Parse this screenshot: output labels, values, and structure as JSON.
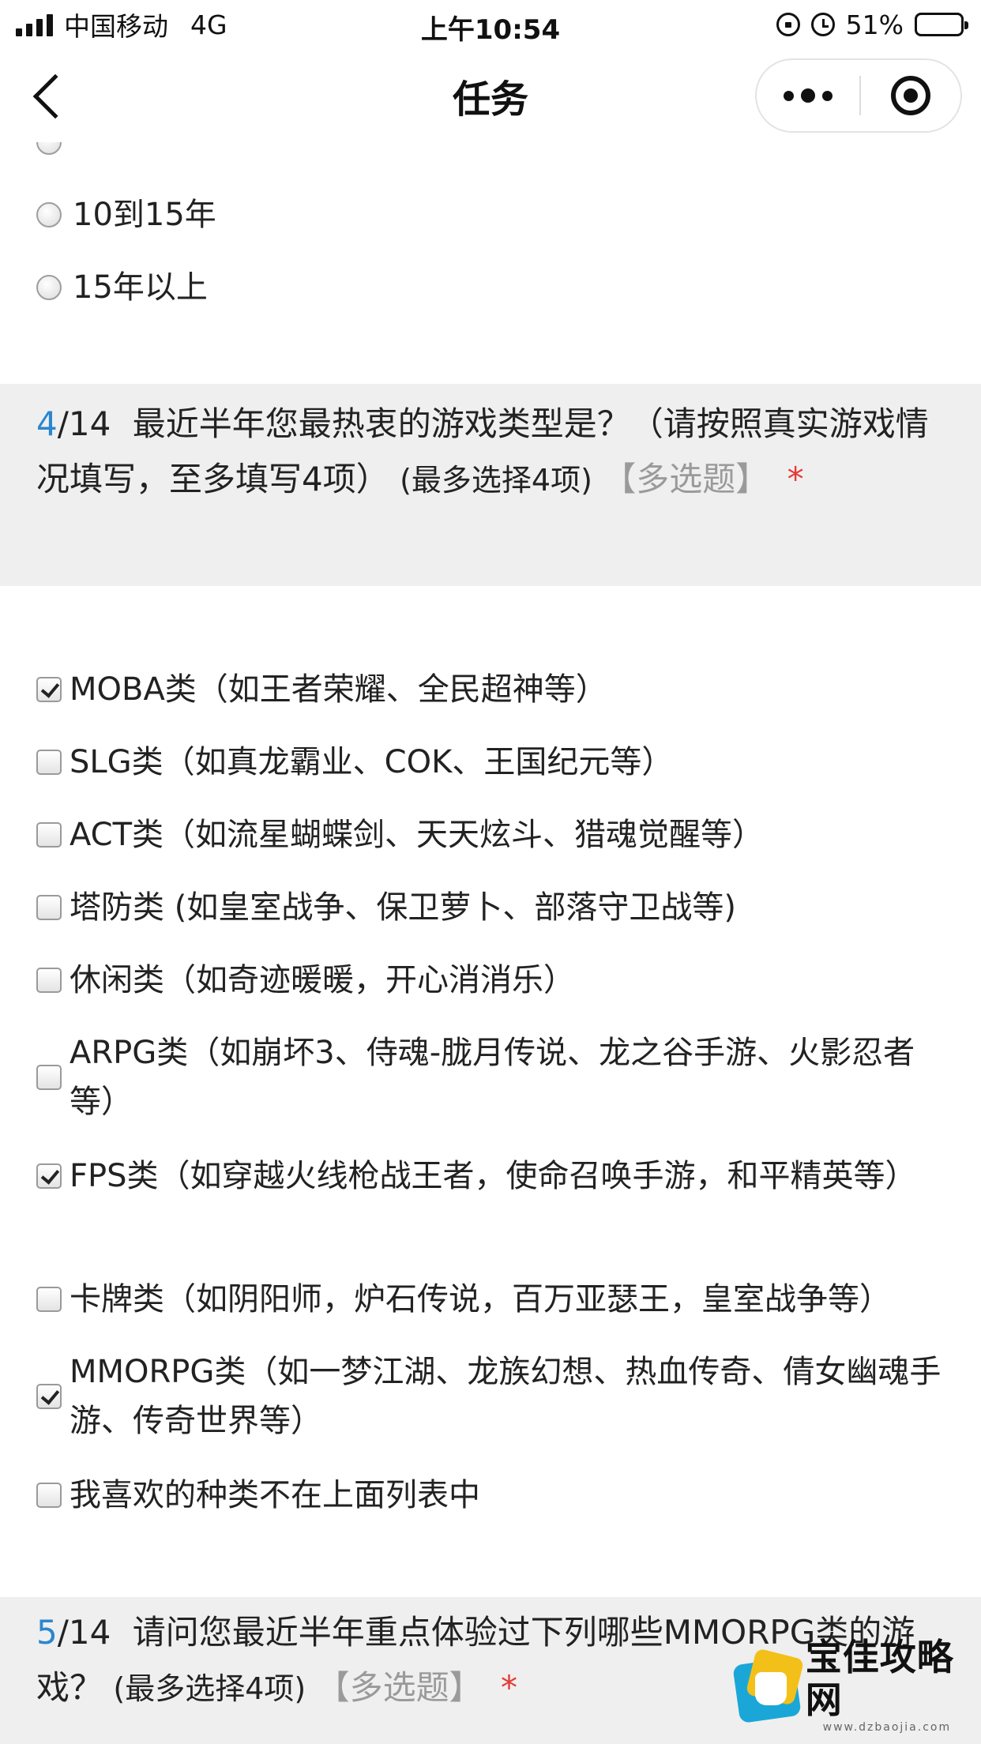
{
  "status_bar": {
    "carrier": "中国移动",
    "network": "4G",
    "time": "上午10:54",
    "battery": "51%",
    "battery_level": 0.51
  },
  "nav": {
    "title": "任务"
  },
  "q3": {
    "options": [
      {
        "label": "10到15年",
        "selected": false
      },
      {
        "label": "15年以上",
        "selected": false
      }
    ]
  },
  "q4": {
    "number": "4",
    "total": "/14",
    "title": "最近半年您最热衷的游戏类型是？（请按照真实游戏情况填写，至多填写4项）",
    "limit": "(最多选择4项)",
    "type_tag": "【多选题】",
    "required_mark": "*",
    "options": [
      {
        "label": "MOBA类（如王者荣耀、全民超神等）",
        "checked": true
      },
      {
        "label": "SLG类（如真龙霸业、COK、王国纪元等）",
        "checked": false
      },
      {
        "label": "ACT类（如流星蝴蝶剑、天天炫斗、猎魂觉醒等）",
        "checked": false
      },
      {
        "label": "塔防类 (如皇室战争、保卫萝卜、部落守卫战等)",
        "checked": false
      },
      {
        "label": "休闲类（如奇迹暖暖，开心消消乐）",
        "checked": false
      },
      {
        "label": "ARPG类（如崩坏3、侍魂-胧月传说、龙之谷手游、火影忍者等）",
        "checked": false
      },
      {
        "label": "FPS类（如穿越火线枪战王者，使命召唤手游，和平精英等）",
        "checked": true
      },
      {
        "label": "卡牌类（如阴阳师，炉石传说，百万亚瑟王，皇室战争等）",
        "checked": false
      },
      {
        "label": "MMORPG类（如一梦江湖、龙族幻想、热血传奇、倩女幽魂手游、传奇世界等）",
        "checked": true
      },
      {
        "label": "我喜欢的种类不在上面列表中",
        "checked": false
      }
    ]
  },
  "q5": {
    "number": "5",
    "total": "/14",
    "title": "请问您最近半年重点体验过下列哪些MMORPG类的游戏？",
    "limit": "(最多选择4项)",
    "type_tag": "【多选题】",
    "required_mark": "*"
  },
  "watermark": {
    "name": "宝佳攻略网",
    "url": "www.dzbaojia.com"
  }
}
